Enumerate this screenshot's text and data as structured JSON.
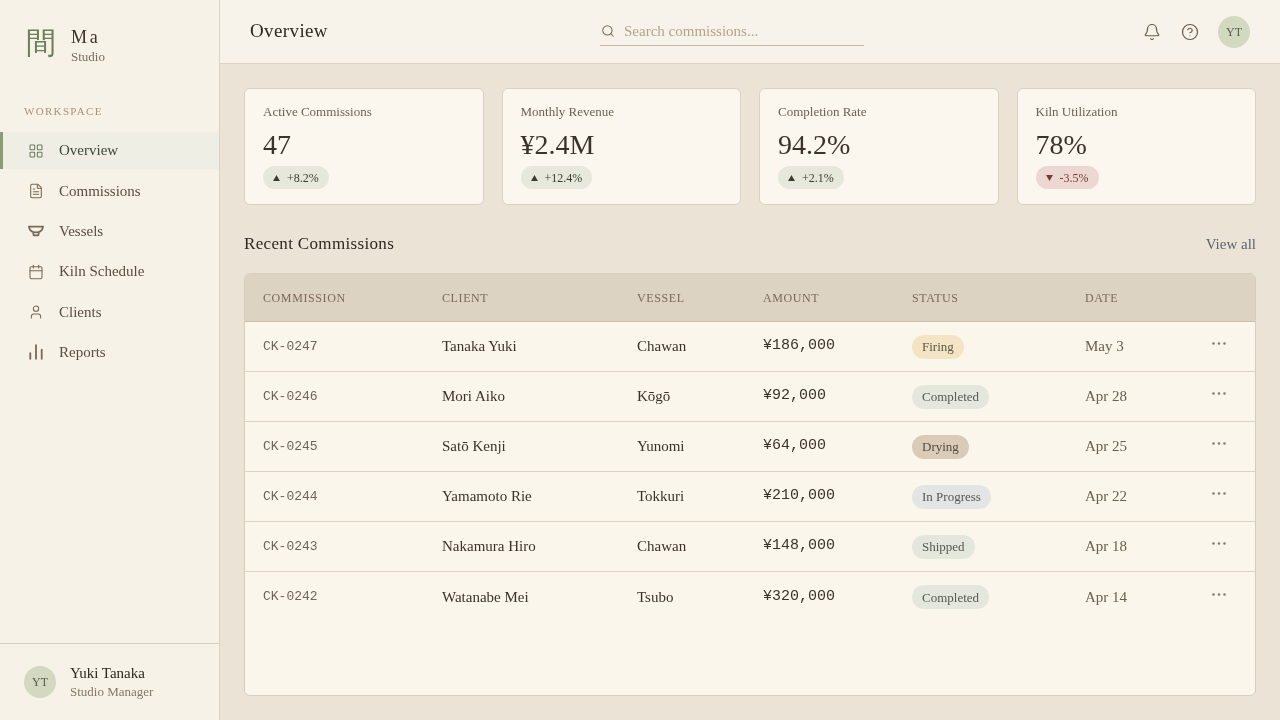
{
  "sidebar": {
    "logo": {
      "mark": "間",
      "name": "Ma",
      "subtitle": "Studio"
    },
    "section_label": "WORKSPACE",
    "items": [
      {
        "label": "Overview",
        "selected": true
      },
      {
        "label": "Commissions",
        "selected": false
      },
      {
        "label": "Vessels",
        "selected": false
      },
      {
        "label": "Kiln Schedule",
        "selected": false
      },
      {
        "label": "Clients",
        "selected": false
      },
      {
        "label": "Reports",
        "selected": false
      }
    ],
    "user": {
      "initials": "YT",
      "name": "Yuki Tanaka",
      "role": "Studio Manager"
    }
  },
  "header": {
    "title": "Overview",
    "search": {
      "placeholder": "Search commissions..."
    },
    "avatar": "YT"
  },
  "stats": [
    {
      "label": "Active Commissions",
      "value": "47",
      "change": "+8.2%",
      "rising": true
    },
    {
      "label": "Monthly Revenue",
      "value": "¥2.4M",
      "change": "+12.4%",
      "rising": true
    },
    {
      "label": "Completion Rate",
      "value": "94.2%",
      "change": "+2.1%",
      "rising": true
    },
    {
      "label": "Kiln Utilization",
      "value": "78%",
      "change": "-3.5%",
      "rising": false
    }
  ],
  "recent": {
    "title": "Recent Commissions",
    "link": "View all",
    "table": {
      "columns": [
        "COMMISSION",
        "CLIENT",
        "VESSEL",
        "AMOUNT",
        "STATUS",
        "DATE"
      ],
      "rows": [
        {
          "commission": "CK-0247",
          "client": "Tanaka Yuki",
          "vessel": "Chawan",
          "amount": "¥186,000",
          "status": {
            "label": "Firing",
            "color": "#f3e4c4"
          },
          "date": "May 3"
        },
        {
          "commission": "CK-0246",
          "client": "Mori Aiko",
          "vessel": "Kōgō",
          "amount": "¥92,000",
          "status": {
            "label": "Completed",
            "color": "#e4e7db"
          },
          "date": "Apr 28"
        },
        {
          "commission": "CK-0245",
          "client": "Satō Kenji",
          "vessel": "Yunomi",
          "amount": "¥64,000",
          "status": {
            "label": "Drying",
            "color": "#d9cbb6"
          },
          "date": "Apr 25"
        },
        {
          "commission": "CK-0244",
          "client": "Yamamoto Rie",
          "vessel": "Tokkuri",
          "amount": "¥210,000",
          "status": {
            "label": "In Progress",
            "color": "#e2e5e4"
          },
          "date": "Apr 22"
        },
        {
          "commission": "CK-0243",
          "client": "Nakamura Hiro",
          "vessel": "Chawan",
          "amount": "¥148,000",
          "status": {
            "label": "Shipped",
            "color": "#e4e7db"
          },
          "date": "Apr 18"
        },
        {
          "commission": "CK-0242",
          "client": "Watanabe Mei",
          "vessel": "Tsubo",
          "amount": "¥320,000",
          "status": {
            "label": "Completed",
            "color": "#e4e7db"
          },
          "date": "Apr 14"
        }
      ]
    }
  }
}
